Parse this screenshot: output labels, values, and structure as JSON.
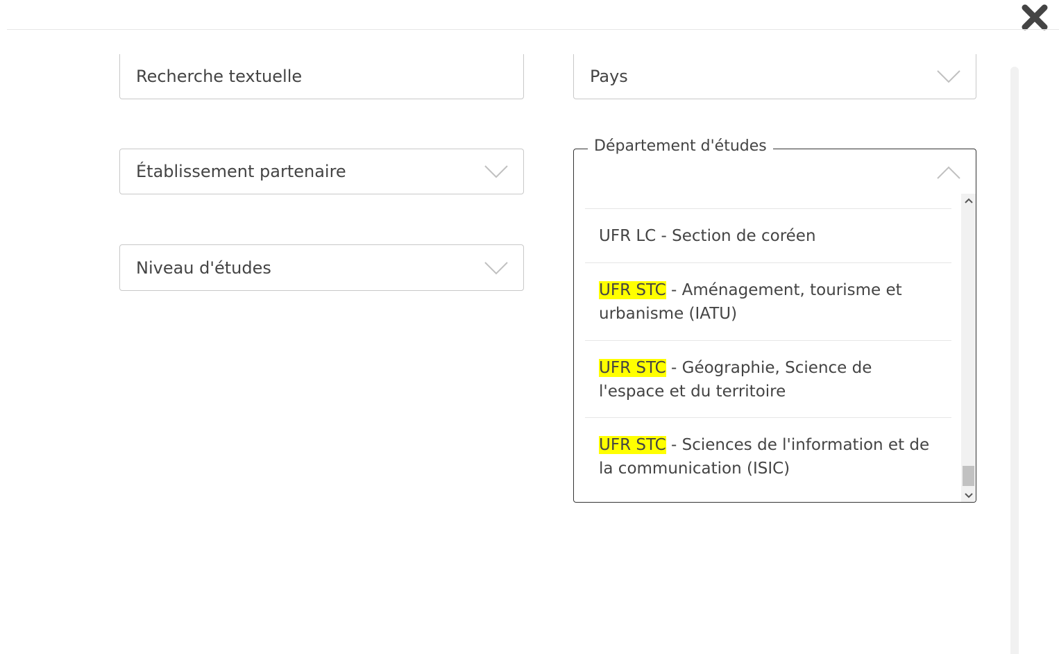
{
  "dialog": {
    "close_icon": "close-icon"
  },
  "filters": {
    "text_search": {
      "placeholder": "Recherche textuelle"
    },
    "country": {
      "label": "Pays",
      "icon": "chevron-down-icon"
    },
    "partner_institution": {
      "label": "Établissement partenaire",
      "icon": "chevron-down-icon"
    },
    "study_level": {
      "label": "Niveau d'études",
      "icon": "chevron-down-icon"
    },
    "department": {
      "legend": "Département d'études",
      "icon": "chevron-up-icon",
      "options": [
        {
          "highlight": "",
          "text": "UFR LC - Section de coréen"
        },
        {
          "highlight": "UFR STC",
          "text": " - Aménagement, tourisme et urbanisme (IATU)"
        },
        {
          "highlight": "UFR STC",
          "text": " - Géographie, Science de l'espace et du territoire"
        },
        {
          "highlight": "UFR STC",
          "text": " - Sciences de l'information et de la communication (ISIC)"
        }
      ]
    }
  },
  "colors": {
    "highlight": "#ffff00",
    "border": "#c8c8c8",
    "open_border": "#333333"
  }
}
